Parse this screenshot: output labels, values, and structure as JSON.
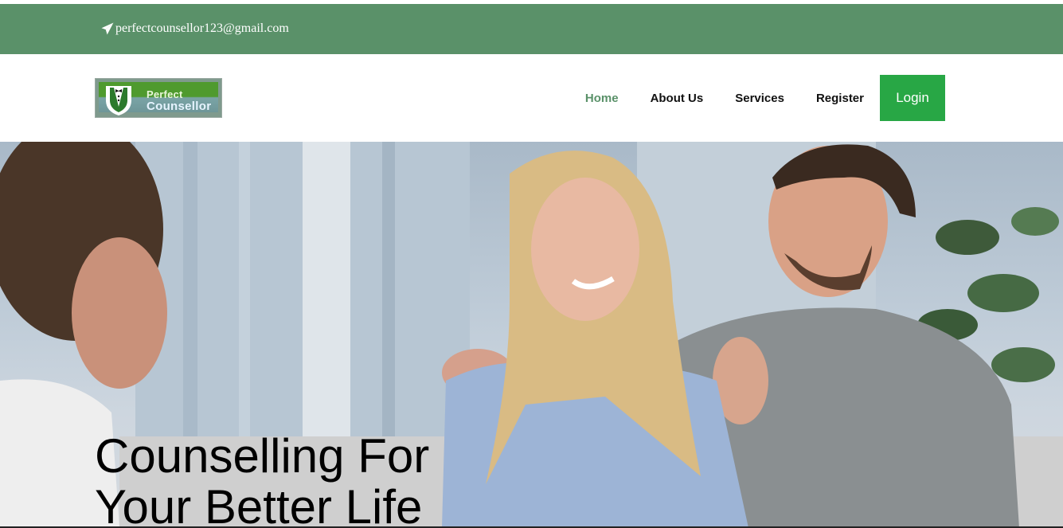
{
  "topbar": {
    "email": "perfectcounsellor123@gmail.com",
    "icon": "paper-plane-icon",
    "background": "#5a9169"
  },
  "header": {
    "logo": {
      "line1": "Perfect",
      "line2": "Counsellor"
    },
    "nav": [
      {
        "label": "Home",
        "active": true
      },
      {
        "label": "About Us"
      },
      {
        "label": "Services"
      },
      {
        "label": "Register"
      }
    ],
    "login_label": "Login",
    "accent_color": "#28a745"
  },
  "hero": {
    "heading_line1": "Counselling For",
    "heading_line2": "Your Better Life"
  }
}
